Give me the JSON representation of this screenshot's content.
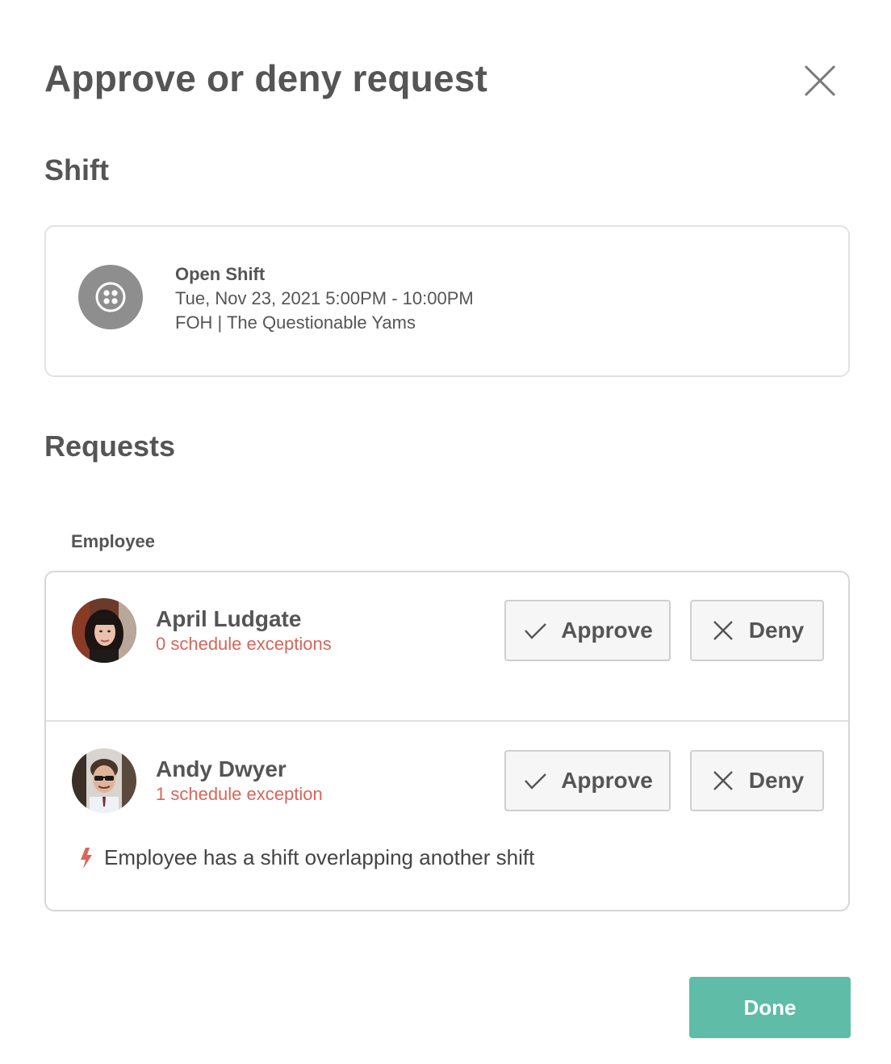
{
  "dialog": {
    "title": "Approve or deny request",
    "close_icon": "close-icon"
  },
  "shift": {
    "heading": "Shift",
    "name": "Open Shift",
    "datetime": "Tue, Nov 23, 2021 5:00PM - 10:00PM",
    "location": "FOH | The Questionable Yams",
    "icon": "open-shift-icon"
  },
  "requests": {
    "heading": "Requests",
    "column_label": "Employee",
    "rows": [
      {
        "name": "April Ludgate",
        "exceptions": "0 schedule exceptions",
        "approve_label": "Approve",
        "deny_label": "Deny"
      },
      {
        "name": "Andy Dwyer",
        "exceptions": "1 schedule exception",
        "approve_label": "Approve",
        "deny_label": "Deny",
        "warning": "Employee has a shift overlapping another shift"
      }
    ]
  },
  "footer": {
    "done_label": "Done"
  },
  "colors": {
    "accent": "#5fbca6",
    "exception": "#d9655b",
    "text": "#555555"
  }
}
